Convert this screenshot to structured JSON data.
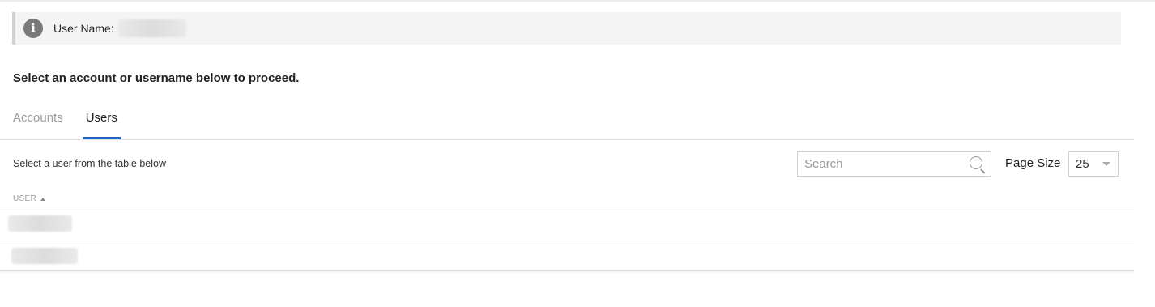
{
  "banner": {
    "label": "User Name:",
    "icon": "info-icon",
    "icon_glyph": "i"
  },
  "instruction": "Select an account or username below to proceed.",
  "tabs": [
    {
      "label": "Accounts",
      "active": false
    },
    {
      "label": "Users",
      "active": true
    }
  ],
  "table": {
    "hint": "Select a user from the table below",
    "search_placeholder": "Search",
    "page_size_label": "Page Size",
    "page_size_value": "25",
    "column_header": "USER",
    "sort": "ascending"
  },
  "colors": {
    "accent": "#1f63c6",
    "banner_bg": "#f4f4f4"
  }
}
